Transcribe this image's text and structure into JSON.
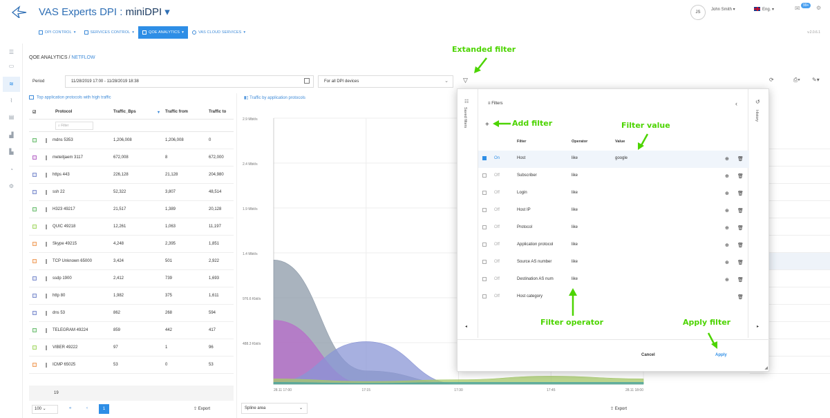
{
  "header": {
    "brand": "VAS Experts DPI",
    "product": "miniDPI",
    "user_initials": "JS",
    "user_name": "John Smith",
    "language": "Eng.",
    "notif_count": "99+",
    "version": "v.2.0.6.1"
  },
  "nav": [
    {
      "label": "DPI CONTROL",
      "active": false
    },
    {
      "label": "SERVICES CONTROL",
      "active": false
    },
    {
      "label": "QOE ANALYTICS",
      "active": true
    },
    {
      "label": "VAS CLOUD SERVICES",
      "active": false
    }
  ],
  "breadcrumb": {
    "section": "QOE ANALYTICS",
    "page": "NETFLOW"
  },
  "period": {
    "label": "Period",
    "value": "11/28/2019 17:00 - 11/28/2019 18:38"
  },
  "device_select": "For all DPI devices",
  "left_panel": {
    "title": "Top application protocols with high traffic",
    "columns": [
      "Protocol",
      "Traffic_Bps",
      "Traffic from",
      "Traffic to"
    ],
    "filter_placeholder": "Filter",
    "rows": [
      {
        "protocol": "mdns 5353",
        "bps": "1,206,008",
        "from": "1,206,008",
        "to": "0",
        "color": "#6fbf73"
      },
      {
        "protocol": "meteitjaem 3117",
        "bps": "672,008",
        "from": "8",
        "to": "672,000",
        "color": "#b86bc9"
      },
      {
        "protocol": "https 443",
        "bps": "226,128",
        "from": "21,128",
        "to": "204,980",
        "color": "#7f8fcf"
      },
      {
        "protocol": "ssh 22",
        "bps": "52,322",
        "from": "3,807",
        "to": "48,514",
        "color": "#7f8fcf"
      },
      {
        "protocol": "H323 49217",
        "bps": "21,517",
        "from": "1,389",
        "to": "20,128",
        "color": "#6fbf73"
      },
      {
        "protocol": "QUIC 49218",
        "bps": "12,261",
        "from": "1,063",
        "to": "11,197",
        "color": "#a6d96a"
      },
      {
        "protocol": "Skype 49215",
        "bps": "4,248",
        "from": "2,395",
        "to": "1,851",
        "color": "#f0a060"
      },
      {
        "protocol": "TCP Unknown 65000",
        "bps": "3,424",
        "from": "501",
        "to": "2,922",
        "color": "#f0a060"
      },
      {
        "protocol": "ssdp 1900",
        "bps": "2,412",
        "from": "739",
        "to": "1,693",
        "color": "#7f8fcf"
      },
      {
        "protocol": "http 80",
        "bps": "1,982",
        "from": "375",
        "to": "1,611",
        "color": "#7f8fcf"
      },
      {
        "protocol": "dns 53",
        "bps": "862",
        "from": "268",
        "to": "594",
        "color": "#7f8fcf"
      },
      {
        "protocol": "TELEGRAM 49224",
        "bps": "859",
        "from": "442",
        "to": "417",
        "color": "#6fbf73"
      },
      {
        "protocol": "VIBER 49222",
        "bps": "97",
        "from": "1",
        "to": "96",
        "color": "#a6d96a"
      },
      {
        "protocol": "ICMP 65025",
        "bps": "53",
        "from": "0",
        "to": "53",
        "color": "#f0a060"
      }
    ],
    "total": "19",
    "page_size": "100",
    "current_page": "1",
    "export_label": "Export"
  },
  "chart_panel": {
    "title": "Traffic by application protocols",
    "chart_type": "Spline area",
    "export_label": "Export"
  },
  "chart_data": {
    "type": "area",
    "title": "Traffic by application protocols",
    "x": [
      "28.11 17:00",
      "17:15",
      "17:30",
      "17:45",
      "28.11 18:00"
    ],
    "y_ticks": [
      "2.9 Mbit/s",
      "2.4 Mbit/s",
      "1.9 Mbit/s",
      "1.4 Mbit/s",
      "976.6 Kbit/s",
      "488.3 Kbit/s"
    ],
    "series": [
      {
        "color": "#8c99a8",
        "values": [
          1400,
          150,
          0,
          0,
          0
        ]
      },
      {
        "color": "#b86bc9",
        "values": [
          720,
          0,
          0,
          0,
          0
        ]
      },
      {
        "color": "#8a95d6",
        "values": [
          20,
          480,
          0,
          0,
          0
        ]
      },
      {
        "color": "#a6c96a",
        "values": [
          60,
          30,
          50,
          90,
          60
        ]
      },
      {
        "color": "#4aa3a0",
        "values": [
          20,
          10,
          20,
          20,
          20
        ]
      }
    ]
  },
  "filter_dialog": {
    "saved_filters_label": "Saved filters",
    "history_label": "History",
    "title": "Filters",
    "columns": [
      "Filter",
      "Operator",
      "Value"
    ],
    "rows": [
      {
        "state": "On",
        "filter": "Host",
        "operator": "like",
        "value": "google",
        "checked": true
      },
      {
        "state": "Off",
        "filter": "Subscriber",
        "operator": "like",
        "value": "",
        "checked": false
      },
      {
        "state": "Off",
        "filter": "Login",
        "operator": "like",
        "value": "",
        "checked": false
      },
      {
        "state": "Off",
        "filter": "Host IP",
        "operator": "like",
        "value": "",
        "checked": false
      },
      {
        "state": "Off",
        "filter": "Protocol",
        "operator": "like",
        "value": "",
        "checked": false
      },
      {
        "state": "Off",
        "filter": "Application protocol",
        "operator": "like",
        "value": "",
        "checked": false
      },
      {
        "state": "Off",
        "filter": "Source AS number",
        "operator": "like",
        "value": "",
        "checked": false
      },
      {
        "state": "Off",
        "filter": "Destination AS num",
        "operator": "like",
        "value": "",
        "checked": false
      },
      {
        "state": "Off",
        "filter": "Host category",
        "operator": "",
        "value": "",
        "checked": false
      }
    ],
    "cancel_label": "Cancel",
    "apply_label": "Apply"
  },
  "annotations": {
    "extended_filter": "Extanded filter",
    "add_filter": "Add filter",
    "filter_value": "Filter value",
    "filter_operator": "Filter operator",
    "apply_filter": "Apply filter"
  }
}
